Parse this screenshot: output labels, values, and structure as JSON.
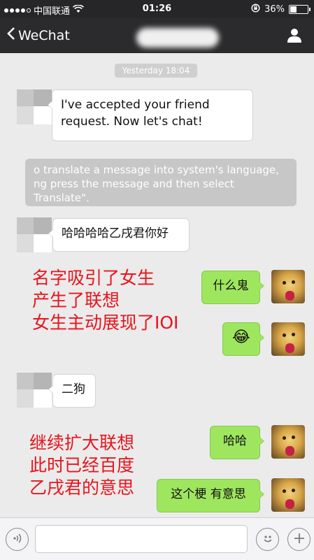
{
  "status_bar": {
    "carrier": "中国联通",
    "time": "01:26",
    "battery": "36%"
  },
  "nav": {
    "back_label": "WeChat",
    "contact_icon": "person-icon"
  },
  "chat": {
    "timestamp": "Yesterday 18:04",
    "messages": [
      {
        "from": "other",
        "text_lines": [
          "I've accepted your friend",
          "request. Now let's chat!"
        ]
      },
      {
        "from": "system",
        "text_lines": [
          "o translate a message into system's language,",
          "ng press the message and then select",
          "Translate\"."
        ]
      },
      {
        "from": "other",
        "text": "哈哈哈哈乙戌君你好"
      },
      {
        "from": "me",
        "text": "什么鬼"
      },
      {
        "from": "me",
        "emoji": "😂",
        "icon": "laughing-emoji-icon"
      },
      {
        "from": "other",
        "text": "二狗"
      },
      {
        "from": "me",
        "text": "哈哈"
      },
      {
        "from": "me",
        "text": "这个梗 有意思"
      }
    ]
  },
  "annotations": [
    {
      "lines": [
        "名字吸引了女生",
        "产生了联想",
        "女生主动展现了IOI"
      ]
    },
    {
      "lines": [
        "继续扩大联想",
        "此时已经百度",
        "乙戌君的意思"
      ]
    }
  ],
  "input_bar": {
    "voice_icon": "voice-icon",
    "emoji_icon": "emoji-icon",
    "plus_icon": "plus-icon",
    "value": ""
  },
  "colors": {
    "sent_bubble": "#9fe65f",
    "annotation": "#e8141c",
    "nav_background": "#2b2b2d"
  }
}
